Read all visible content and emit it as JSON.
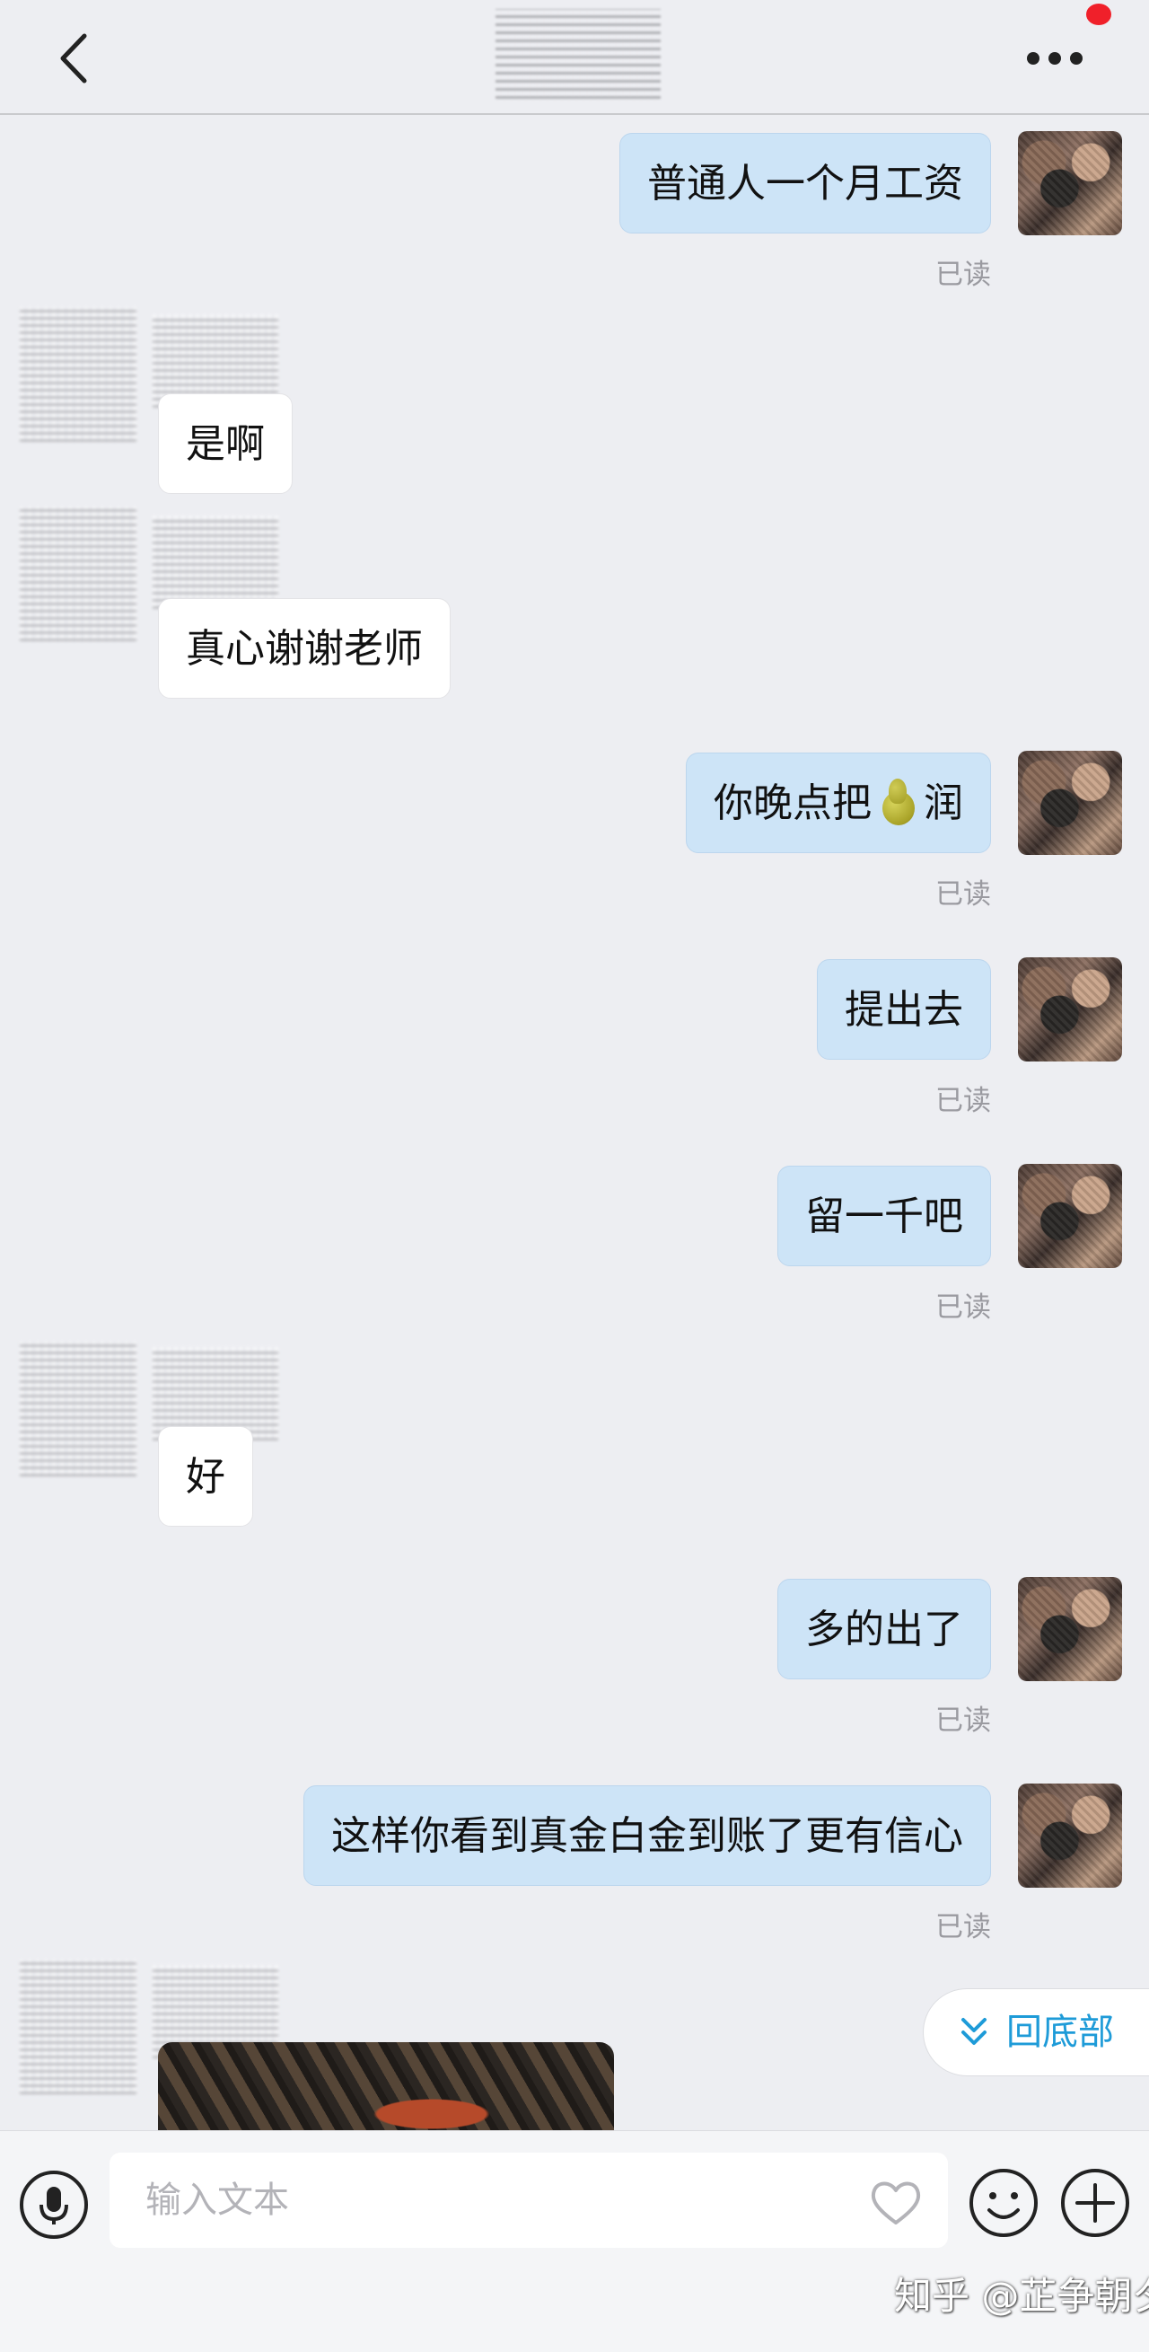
{
  "header": {
    "back_icon": "chevron-left-icon",
    "more_icon": "more-horizontal-icon",
    "badge_color": "#f0202a"
  },
  "messages": [
    {
      "side": "out",
      "text": "普通人一个月工资",
      "status": "已读"
    },
    {
      "side": "in",
      "text": "是啊"
    },
    {
      "side": "in",
      "text": "真心谢谢老师"
    },
    {
      "side": "out",
      "text_before": "你晚点把",
      "emoji": "pear-emoji",
      "text_after": "润",
      "status": "已读"
    },
    {
      "side": "out",
      "text": "提出去",
      "status": "已读"
    },
    {
      "side": "out",
      "text": "留一千吧",
      "status": "已读"
    },
    {
      "side": "in",
      "text": "好"
    },
    {
      "side": "out",
      "text": "多的出了",
      "status": "已读"
    },
    {
      "side": "out",
      "text": "这样你看到真金白金到账了更有信心",
      "status": "已读"
    },
    {
      "side": "in",
      "type": "image"
    }
  ],
  "back_to_bottom": {
    "label": "回底部",
    "icon": "double-chevron-down-icon"
  },
  "input_bar": {
    "placeholder": "输入文本",
    "mic_icon": "microphone-icon",
    "heart_icon": "heart-icon",
    "emoji_icon": "smiley-icon",
    "plus_icon": "plus-circle-icon"
  },
  "watermark": "知乎 @芷争朝夕",
  "colors": {
    "outgoing_bubble": "#cde4f7",
    "incoming_bubble": "#ffffff",
    "background": "#edeef2",
    "accent": "#1e9bd8"
  }
}
